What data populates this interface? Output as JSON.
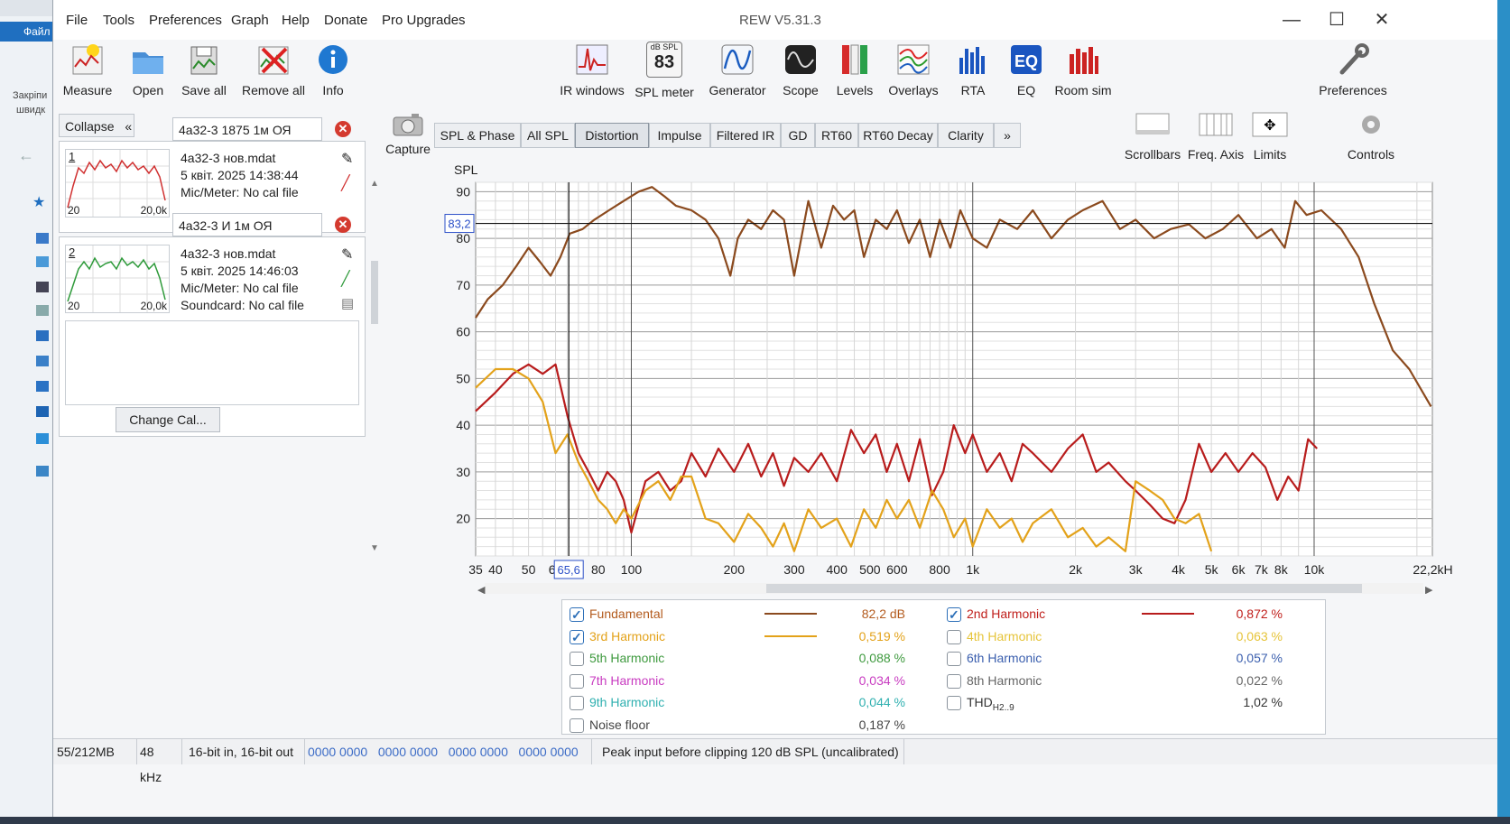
{
  "desktop": {
    "file_label": "Файл",
    "side_label_1": "Закріпи",
    "side_label_2": "швидк"
  },
  "window": {
    "title": "REW V5.31.3",
    "menu": [
      "File",
      "Tools",
      "Preferences",
      "Graph",
      "Help",
      "Donate",
      "Pro Upgrades"
    ],
    "controls": {
      "minimize": "—",
      "maximize": "☐",
      "close": "✕"
    }
  },
  "toolbar": {
    "left": [
      "Measure",
      "Open",
      "Save all",
      "Remove all",
      "Info"
    ],
    "center": [
      "IR windows",
      "SPL meter",
      "Generator",
      "Scope",
      "Levels",
      "Overlays",
      "RTA",
      "EQ",
      "Room sim"
    ],
    "spl_meter_badge": {
      "top": "dB SPL",
      "value": "83"
    },
    "right": "Preferences"
  },
  "panel": {
    "collapse_label": "Collapse",
    "measurements": [
      {
        "index": "1",
        "name": "4a32-3 1875 1м ОЯ",
        "file": "4a32-3 нов.mdat",
        "date": "5 квіт. 2025 14:38:44",
        "mic": "Mic/Meter: No cal file",
        "thumb_left": "20",
        "thumb_right": "20,0k",
        "color": "#d03030"
      },
      {
        "index": "2",
        "name": "4a32-3 И 1м ОЯ",
        "file": "4a32-3 нов.mdat",
        "date": "5 квіт. 2025 14:46:03",
        "mic": "Mic/Meter: No cal file",
        "soundcard": "Soundcard: No cal file",
        "thumb_left": "20",
        "thumb_right": "20,0k",
        "color": "#2e9a3a"
      }
    ],
    "change_cal_label": "Change Cal..."
  },
  "graph_tabs": [
    "SPL & Phase",
    "All SPL",
    "Distortion",
    "Impulse",
    "Filtered IR",
    "GD",
    "RT60",
    "RT60 Decay",
    "Clarity",
    "»"
  ],
  "active_tab": "Distortion",
  "capture_label": "Capture",
  "right_tools": [
    "Scrollbars",
    "Freq. Axis",
    "Limits",
    "Controls"
  ],
  "chart_data": {
    "type": "line",
    "ylabel": "SPL",
    "xscale": "log",
    "xlim": [
      35,
      22200
    ],
    "ylim": [
      12,
      92
    ],
    "y_ticks": [
      20,
      30,
      40,
      50,
      60,
      70,
      80,
      90
    ],
    "x_ticks": [
      "35",
      "40",
      "50",
      "60",
      "80",
      "100",
      "200",
      "300",
      "400",
      "500",
      "600",
      "800",
      "1k",
      "2k",
      "3k",
      "4k",
      "5k",
      "6k",
      "7k",
      "8k",
      "10k",
      "22,2kHz"
    ],
    "cursor": {
      "x_label": "65,6",
      "x_value": 65.6,
      "y_label": "83,2",
      "y_value": 83.2
    },
    "grid": true,
    "series": [
      {
        "name": "Fundamental",
        "color": "#8b4a1e",
        "x": [
          35,
          38,
          42,
          46,
          50,
          54,
          58,
          62,
          66,
          72,
          78,
          86,
          95,
          105,
          115,
          125,
          135,
          150,
          165,
          180,
          195,
          205,
          220,
          240,
          260,
          280,
          300,
          330,
          360,
          390,
          420,
          450,
          480,
          520,
          560,
          600,
          650,
          700,
          750,
          800,
          860,
          920,
          1000,
          1100,
          1200,
          1350,
          1500,
          1700,
          1900,
          2100,
          2400,
          2700,
          3000,
          3400,
          3800,
          4300,
          4800,
          5400,
          6000,
          6800,
          7500,
          8200,
          8800,
          9500,
          10500,
          12000,
          13500,
          15000,
          17000,
          19000,
          22000
        ],
        "y": [
          63,
          67,
          70,
          74,
          78,
          75,
          72,
          76,
          81,
          82,
          84,
          86,
          88,
          90,
          91,
          89,
          87,
          86,
          84,
          80,
          72,
          80,
          84,
          82,
          86,
          84,
          72,
          88,
          78,
          87,
          84,
          86,
          76,
          84,
          82,
          86,
          79,
          84,
          76,
          84,
          78,
          86,
          80,
          78,
          84,
          82,
          86,
          80,
          84,
          86,
          88,
          82,
          84,
          80,
          82,
          83,
          80,
          82,
          85,
          80,
          82,
          78,
          88,
          85,
          86,
          82,
          76,
          66,
          56,
          52,
          44
        ]
      },
      {
        "name": "2nd Harmonic",
        "color": "#b81c1c",
        "x": [
          35,
          40,
          45,
          50,
          55,
          60,
          65,
          70,
          75,
          80,
          85,
          90,
          95,
          100,
          110,
          120,
          130,
          140,
          150,
          165,
          180,
          200,
          220,
          240,
          260,
          280,
          300,
          330,
          360,
          400,
          440,
          480,
          520,
          560,
          600,
          650,
          700,
          760,
          820,
          880,
          950,
          1000,
          1100,
          1200,
          1300,
          1400,
          1500,
          1700,
          1900,
          2100,
          2300,
          2500,
          2800,
          3000,
          3300,
          3600,
          3900,
          4200,
          4600,
          5000,
          5500,
          6000,
          6600,
          7200,
          7800,
          8400,
          9000,
          9600,
          10200
        ],
        "y": [
          43,
          47,
          51,
          53,
          51,
          53,
          42,
          34,
          30,
          26,
          30,
          28,
          24,
          17,
          28,
          30,
          26,
          28,
          34,
          29,
          35,
          30,
          36,
          29,
          34,
          27,
          33,
          30,
          34,
          28,
          39,
          34,
          38,
          30,
          36,
          28,
          37,
          25,
          30,
          40,
          34,
          38,
          30,
          34,
          28,
          36,
          34,
          30,
          35,
          38,
          30,
          32,
          28,
          26,
          23,
          20,
          19,
          24,
          36,
          30,
          34,
          30,
          34,
          31,
          24,
          29,
          26,
          37,
          35
        ]
      },
      {
        "name": "3rd Harmonic",
        "color": "#e3a21a",
        "x": [
          35,
          40,
          45,
          50,
          55,
          60,
          65,
          70,
          75,
          80,
          85,
          90,
          95,
          100,
          110,
          120,
          130,
          140,
          150,
          165,
          180,
          200,
          220,
          240,
          260,
          280,
          300,
          330,
          360,
          400,
          440,
          480,
          520,
          560,
          600,
          650,
          700,
          760,
          820,
          880,
          950,
          1000,
          1100,
          1200,
          1300,
          1400,
          1500,
          1700,
          1900,
          2100,
          2300,
          2500,
          2800,
          3000,
          3300,
          3600,
          3900,
          4200,
          4600,
          5000
        ],
        "y": [
          48,
          52,
          52,
          50,
          45,
          34,
          38,
          32,
          28,
          24,
          22,
          19,
          22,
          20,
          26,
          28,
          24,
          29,
          29,
          20,
          19,
          15,
          21,
          18,
          14,
          19,
          13,
          22,
          18,
          20,
          14,
          22,
          18,
          24,
          20,
          24,
          18,
          26,
          22,
          16,
          20,
          14,
          22,
          18,
          20,
          15,
          19,
          22,
          16,
          18,
          14,
          16,
          13,
          28,
          26,
          24,
          20,
          19,
          21,
          13
        ]
      }
    ]
  },
  "legend": [
    {
      "label": "Fundamental",
      "value": "82,2 dB",
      "checked": true,
      "color": "#b35b1e",
      "swatch": "#8b4a1e"
    },
    {
      "label": "2nd Harmonic",
      "value": "0,872 %",
      "checked": true,
      "color": "#c0201c",
      "swatch": "#b81c1c"
    },
    {
      "label": "3rd Harmonic",
      "value": "0,519 %",
      "checked": true,
      "color": "#e3a21a",
      "swatch": "#e3a21a"
    },
    {
      "label": "4th Harmonic",
      "value": "0,063 %",
      "checked": false,
      "color": "#e6c43a"
    },
    {
      "label": "5th Harmonic",
      "value": "0,088 %",
      "checked": false,
      "color": "#3f9a3f"
    },
    {
      "label": "6th Harmonic",
      "value": "0,057 %",
      "checked": false,
      "color": "#3b5fae"
    },
    {
      "label": "7th Harmonic",
      "value": "0,034 %",
      "checked": false,
      "color": "#c83bc0"
    },
    {
      "label": "8th Harmonic",
      "value": "0,022 %",
      "checked": false,
      "color": "#666666"
    },
    {
      "label": "9th Harmonic",
      "value": "0,044 %",
      "checked": false,
      "color": "#2fb0b0"
    },
    {
      "label": "THD",
      "sub": "H2..9",
      "value": "1,02 %",
      "checked": false,
      "color": "#333333"
    },
    {
      "label": "Noise floor",
      "value": "0,187 %",
      "checked": false,
      "color": "#444444"
    }
  ],
  "status": {
    "memory": "55/212MB",
    "rate": "48 kHz",
    "bits": "16-bit in, 16-bit out",
    "levels": "0000 0000   0000 0000   0000 0000   0000 0000",
    "message": "Peak input before clipping 120 dB SPL (uncalibrated)"
  }
}
